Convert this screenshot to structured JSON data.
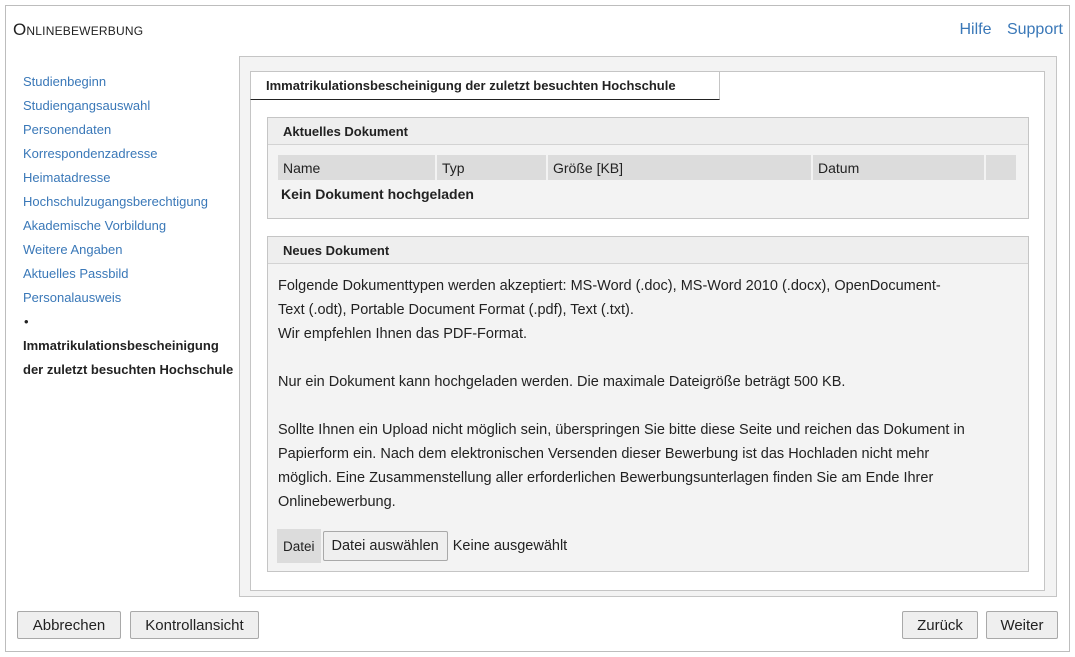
{
  "header": {
    "title": "Onlinebewerbung",
    "links": {
      "help": "Hilfe",
      "support": "Support"
    }
  },
  "sidebar": {
    "items": [
      {
        "label": "Studienbeginn"
      },
      {
        "label": "Studiengangsauswahl"
      },
      {
        "label": "Personendaten"
      },
      {
        "label": "Korrespondenzadresse"
      },
      {
        "label": "Heimatadresse"
      },
      {
        "label": "Hochschulzugangsberechtigung"
      },
      {
        "label": "Akademische Vorbildung"
      },
      {
        "label": "Weitere Angaben"
      },
      {
        "label": "Aktuelles Passbild"
      },
      {
        "label": "Personalausweis"
      }
    ],
    "bullet": "•",
    "current_line1": "Immatrikulationsbescheinigung",
    "current_line2": "der zuletzt besuchten Hochschule"
  },
  "main": {
    "tab_label": "Immatrikulationsbescheinigung der zuletzt besuchten Hochschule",
    "current_document": {
      "heading": "Aktuelles Dokument",
      "columns": [
        "Name",
        "Typ",
        "Größe [KB]",
        "Datum",
        ""
      ],
      "empty_text": "Kein Dokument hochgeladen"
    },
    "new_document": {
      "heading": "Neues Dokument",
      "para1_line1": "Folgende Dokumenttypen werden akzeptiert: MS-Word (.doc), MS-Word 2010 (.docx), OpenDocument-",
      "para1_line2": "Text (.odt), Portable Document Format (.pdf), Text (.txt).",
      "para1_line3": "Wir empfehlen Ihnen das PDF-Format.",
      "para2": "Nur ein Dokument kann hochgeladen werden. Die maximale Dateigröße beträgt 500 KB.",
      "para3_line1": "Sollte Ihnen ein Upload nicht möglich sein, überspringen Sie bitte diese Seite und reichen das Dokument in",
      "para3_line2": "Papierform ein. Nach dem elektronischen Versenden dieser Bewerbung ist das Hochladen nicht mehr",
      "para3_line3": "möglich. Eine Zusammenstellung aller erforderlichen Bewerbungsunterlagen finden Sie am Ende Ihrer",
      "para3_line4": "Onlinebewerbung.",
      "file_label": "Datei",
      "file_button": "Datei auswählen",
      "file_status": "Keine ausgewählt"
    }
  },
  "footer": {
    "cancel": "Abbrechen",
    "control_view": "Kontrollansicht",
    "back": "Zurück",
    "next": "Weiter"
  },
  "colors": {
    "link": "#3a78b8",
    "panel_bg": "#f3f3f3",
    "header_cell_bg": "#dcdcdc"
  }
}
